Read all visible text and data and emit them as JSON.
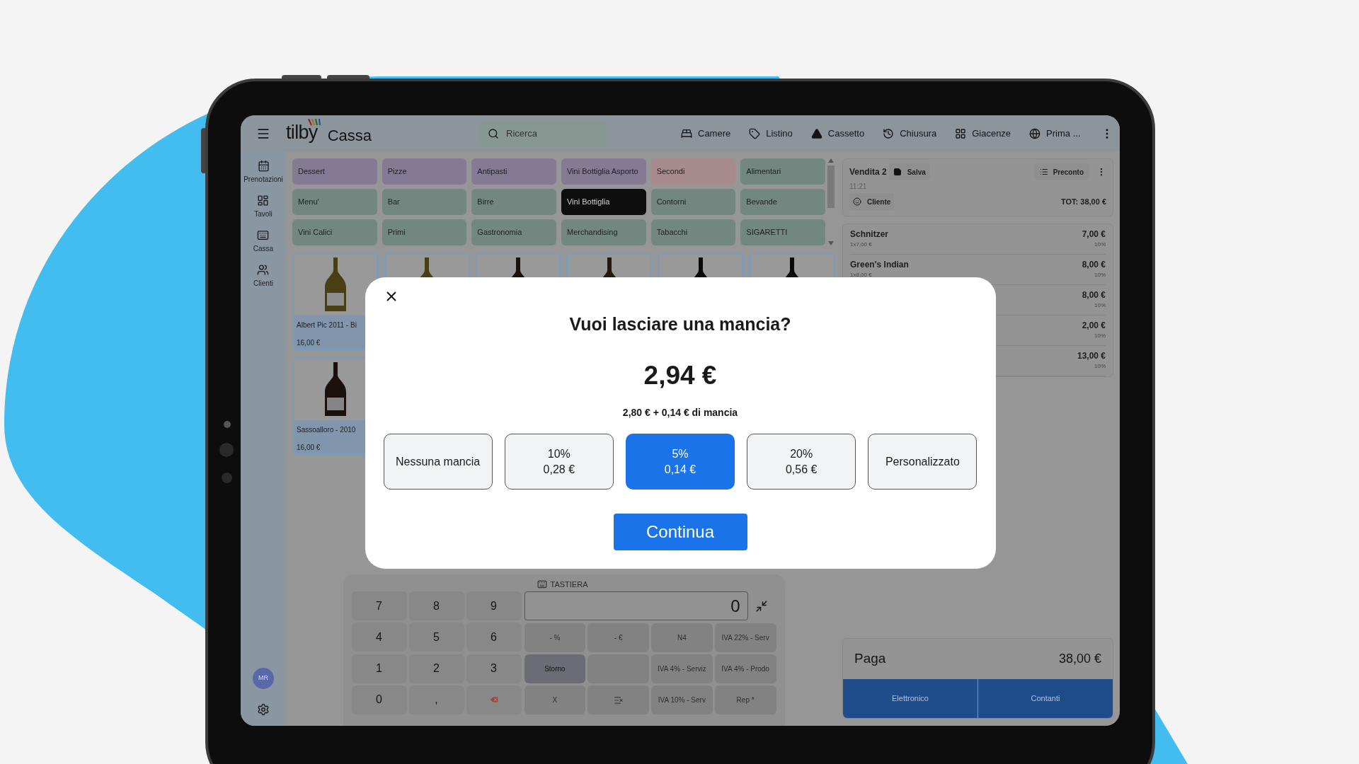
{
  "app": {
    "logo": "tilby",
    "title": "Cassa",
    "search": {
      "placeholder": "Ricerca"
    },
    "nav": [
      {
        "label": "Camere"
      },
      {
        "label": "Listino"
      },
      {
        "label": "Cassetto"
      },
      {
        "label": "Chiusura"
      },
      {
        "label": "Giacenze"
      },
      {
        "label": "Prima ..."
      }
    ],
    "sidebar": {
      "items": [
        {
          "label": "Prenotazioni"
        },
        {
          "label": "Tavoli"
        },
        {
          "label": "Cassa"
        },
        {
          "label": "Clienti"
        }
      ],
      "user": "MR"
    },
    "categories": [
      {
        "label": "Dessert",
        "color": "#857a94",
        "selected": false
      },
      {
        "label": "Pizze",
        "color": "#857a94",
        "selected": false
      },
      {
        "label": "Antipasti",
        "color": "#857a94",
        "selected": false
      },
      {
        "label": "Vini Bottiglia Asporto",
        "color": "#857a94",
        "selected": false
      },
      {
        "label": "Secondi",
        "color": "#a88b8e",
        "selected": false
      },
      {
        "label": "Alimentari",
        "color": "#71877f",
        "selected": false
      },
      {
        "label": "Menu'",
        "color": "#71877f",
        "selected": false
      },
      {
        "label": "Bar",
        "color": "#71877f",
        "selected": false
      },
      {
        "label": "Birre",
        "color": "#71877f",
        "selected": false
      },
      {
        "label": "Vini Bottiglia",
        "selected": true
      },
      {
        "label": "Contorni",
        "color": "#71877f",
        "selected": false
      },
      {
        "label": "Bevande",
        "color": "#71877f",
        "selected": false
      },
      {
        "label": "Vini Calici",
        "color": "#71877f",
        "selected": false
      },
      {
        "label": "Primi",
        "color": "#71877f",
        "selected": false
      },
      {
        "label": "Gastronomia",
        "color": "#71877f",
        "selected": false
      },
      {
        "label": "Merchandising",
        "color": "#71877f",
        "selected": false
      },
      {
        "label": "Tabacchi",
        "color": "#71877f",
        "selected": false
      },
      {
        "label": "SIGARETTI",
        "color": "#71877f",
        "selected": false
      }
    ],
    "products": [
      {
        "name": "Albert Pic 2011 - Bi",
        "price": "16,00 €"
      },
      {
        "name": "Sassoalloro - 2010",
        "price": "16,00 €"
      }
    ],
    "keypad": {
      "label": "TASTIERA",
      "display": "0",
      "digits": [
        {
          "kind": "digit",
          "label": "7"
        },
        {
          "kind": "digit",
          "label": "8"
        },
        {
          "kind": "digit",
          "label": "9"
        },
        {
          "kind": "digit",
          "label": "4"
        },
        {
          "kind": "digit",
          "label": "5"
        },
        {
          "kind": "digit",
          "label": "6"
        },
        {
          "kind": "digit",
          "label": "1"
        },
        {
          "kind": "digit",
          "label": "2"
        },
        {
          "kind": "digit",
          "label": "3"
        },
        {
          "kind": "digit",
          "label": "0"
        },
        {
          "kind": "digit",
          "label": ","
        },
        {
          "kind": "backspace"
        }
      ],
      "functions": [
        {
          "kind": "text",
          "label": "- %",
          "disabled": true
        },
        {
          "kind": "text",
          "label": "- €",
          "disabled": true
        },
        {
          "kind": "text",
          "label": "N4",
          "disabled": true
        },
        {
          "kind": "text",
          "label": "IVA 22% - Serv",
          "disabled": true
        },
        {
          "kind": "text",
          "label": "Storno",
          "disabled": false
        },
        {
          "kind": "blank",
          "disabled": true
        },
        {
          "kind": "text",
          "label": "IVA 4% - Serviz",
          "disabled": true
        },
        {
          "kind": "text",
          "label": "IVA 4% - Prodo",
          "disabled": true
        },
        {
          "kind": "text",
          "label": "X",
          "disabled": true
        },
        {
          "kind": "clear",
          "disabled": true
        },
        {
          "kind": "text",
          "label": "IVA 10% - Serv",
          "disabled": true
        },
        {
          "kind": "text",
          "label": "Rep *",
          "disabled": true
        }
      ]
    },
    "order": {
      "title": "Vendita 2",
      "save": "Salva",
      "precheck": "Preconto",
      "time": "11:21",
      "customer": "Cliente",
      "total": "TOT: 38,00 €",
      "items": [
        {
          "name": "Schnitzer",
          "detail": "1x7,00 €",
          "price": "7,00 €",
          "vat": "10%"
        },
        {
          "name": "Green's Indian",
          "detail": "1x8,00 €",
          "price": "8,00 €",
          "vat": "10%"
        },
        {
          "price": "8,00 €",
          "vat": "10%"
        },
        {
          "price": "2,00 €",
          "vat": "10%"
        },
        {
          "price": "13,00 €",
          "vat": "10%"
        }
      ]
    },
    "pay": {
      "label": "Paga",
      "amount": "38,00 €",
      "methods": [
        "Elettronico",
        "Contanti"
      ]
    }
  },
  "tip_dialog": {
    "title": "Vuoi lasciare una mancia?",
    "amount": "2,94 €",
    "breakdown": "2,80 € + 0,14 € di mancia",
    "options": [
      {
        "label": "Nessuna mancia",
        "selected": false
      },
      {
        "label": "10%",
        "amount": "0,28 €",
        "selected": false
      },
      {
        "label": "5%",
        "amount": "0,14 €",
        "selected": true
      },
      {
        "label": "20%",
        "amount": "0,56 €",
        "selected": false
      },
      {
        "label": "Personalizzato",
        "selected": false
      }
    ],
    "confirm": "Continua"
  }
}
